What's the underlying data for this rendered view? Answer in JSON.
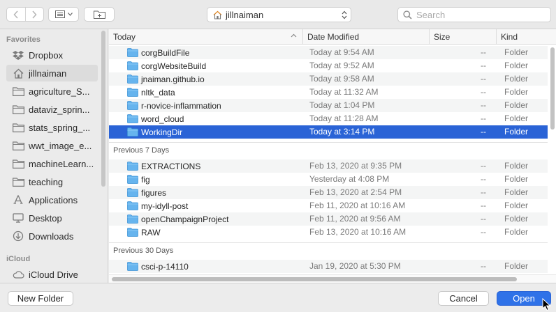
{
  "toolbar": {
    "location": "jillnaiman",
    "search_placeholder": "Search"
  },
  "sidebar": {
    "favorites_heading": "Favorites",
    "favorites": [
      {
        "label": "Dropbox",
        "icon": "dropbox-icon"
      },
      {
        "label": "jillnaiman",
        "icon": "home-icon",
        "selected": true
      },
      {
        "label": "agriculture_S...",
        "icon": "folder-icon"
      },
      {
        "label": "dataviz_sprin...",
        "icon": "folder-icon"
      },
      {
        "label": "stats_spring_...",
        "icon": "folder-icon"
      },
      {
        "label": "wwt_image_e...",
        "icon": "folder-icon"
      },
      {
        "label": "machineLearn...",
        "icon": "folder-icon"
      },
      {
        "label": "teaching",
        "icon": "folder-icon"
      },
      {
        "label": "Applications",
        "icon": "applications-icon"
      },
      {
        "label": "Desktop",
        "icon": "desktop-icon"
      },
      {
        "label": "Downloads",
        "icon": "downloads-icon"
      }
    ],
    "icloud_heading": "iCloud",
    "icloud": [
      {
        "label": "iCloud Drive",
        "icon": "cloud-icon"
      }
    ]
  },
  "columns": {
    "name": "Today",
    "date": "Date Modified",
    "size": "Size",
    "kind": "Kind"
  },
  "groups": [
    {
      "heading": "",
      "rows": [
        {
          "name": "corgBuildFile",
          "date": "Today at 9:54 AM",
          "size": "--",
          "kind": "Folder"
        },
        {
          "name": "corgWebsiteBuild",
          "date": "Today at 9:52 AM",
          "size": "--",
          "kind": "Folder"
        },
        {
          "name": "jnaiman.github.io",
          "date": "Today at 9:58 AM",
          "size": "--",
          "kind": "Folder"
        },
        {
          "name": "nltk_data",
          "date": "Today at 11:32 AM",
          "size": "--",
          "kind": "Folder"
        },
        {
          "name": "r-novice-inflammation",
          "date": "Today at 1:04 PM",
          "size": "--",
          "kind": "Folder"
        },
        {
          "name": "word_cloud",
          "date": "Today at 11:28 AM",
          "size": "--",
          "kind": "Folder"
        },
        {
          "name": "WorkingDir",
          "date": "Today at 3:14 PM",
          "size": "--",
          "kind": "Folder",
          "selected": true
        }
      ]
    },
    {
      "heading": "Previous 7 Days",
      "rows": [
        {
          "name": "EXTRACTIONS",
          "date": "Feb 13, 2020 at 9:35 PM",
          "size": "--",
          "kind": "Folder"
        },
        {
          "name": "fig",
          "date": "Yesterday at 4:08 PM",
          "size": "--",
          "kind": "Folder"
        },
        {
          "name": "figures",
          "date": "Feb 13, 2020 at 2:54 PM",
          "size": "--",
          "kind": "Folder"
        },
        {
          "name": "my-idyll-post",
          "date": "Feb 11, 2020 at 10:16 AM",
          "size": "--",
          "kind": "Folder"
        },
        {
          "name": "openChampaignProject",
          "date": "Feb 11, 2020 at 9:56 AM",
          "size": "--",
          "kind": "Folder"
        },
        {
          "name": "RAW",
          "date": "Feb 13, 2020 at 10:16 AM",
          "size": "--",
          "kind": "Folder"
        }
      ]
    },
    {
      "heading": "Previous 30 Days",
      "rows": [
        {
          "name": "csci-p-14110",
          "date": "Jan 19, 2020 at 5:30 PM",
          "size": "--",
          "kind": "Folder"
        }
      ]
    }
  ],
  "footer": {
    "new_folder": "New Folder",
    "cancel": "Cancel",
    "open": "Open"
  },
  "colors": {
    "selection": "#2a63d6",
    "folder": "#5fb2ec",
    "primary_button": "#2f72e8"
  }
}
